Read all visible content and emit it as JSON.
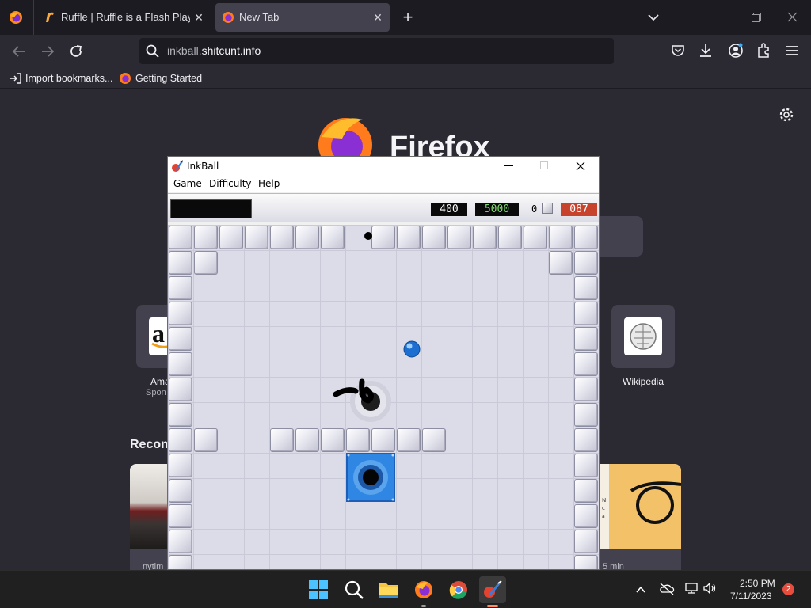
{
  "browser": {
    "tabs": [
      {
        "title": "Ruffle | Ruffle is a Flash Player e",
        "close": "✕"
      },
      {
        "title": "New Tab",
        "close": "✕"
      }
    ],
    "new_tab_button": "+",
    "url": {
      "domain_prefix": "inkball.",
      "domain": "shitcunt.info"
    },
    "bookmarks": [
      {
        "label": "Import bookmarks..."
      },
      {
        "label": "Getting Started"
      }
    ]
  },
  "newtab": {
    "logo_text": "Firefox",
    "shortcuts": [
      {
        "label": "Ama",
        "sublabel": "Spon"
      },
      {
        "label": "Wikipedia",
        "sublabel": ""
      }
    ],
    "recommended_heading": "Recom",
    "stories": [
      {
        "source": "nytim"
      },
      {
        "source": "5 min"
      }
    ]
  },
  "inkball": {
    "title": "InkBall",
    "menu": [
      "Game",
      "Difficulty",
      "Help"
    ],
    "score": "400",
    "high_score": "5000",
    "balls_left": "0",
    "timer": "087"
  },
  "taskbar": {
    "time": "2:50 PM",
    "date": "7/11/2023",
    "notifications": "2"
  },
  "colors": {
    "firefox_bg": "#2b2a33",
    "tabstrip": "#1c1b22",
    "score_green": "#7ed96b",
    "timer_red": "#d9472f",
    "ball_blue": "#2a7ad6",
    "hole_blue": "#2f86e3",
    "board_bg": "#dcdce8"
  }
}
